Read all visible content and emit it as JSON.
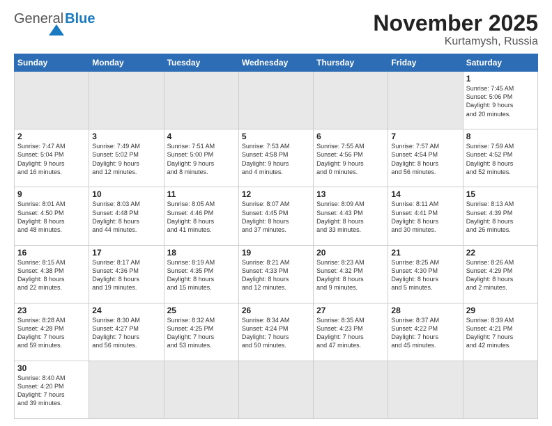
{
  "header": {
    "logo": {
      "general": "General",
      "blue": "Blue"
    },
    "month": "November 2025",
    "location": "Kurtamysh, Russia"
  },
  "weekdays": [
    "Sunday",
    "Monday",
    "Tuesday",
    "Wednesday",
    "Thursday",
    "Friday",
    "Saturday"
  ],
  "weeks": [
    [
      {
        "day": "",
        "info": "",
        "empty": true
      },
      {
        "day": "",
        "info": "",
        "empty": true
      },
      {
        "day": "",
        "info": "",
        "empty": true
      },
      {
        "day": "",
        "info": "",
        "empty": true
      },
      {
        "day": "",
        "info": "",
        "empty": true
      },
      {
        "day": "",
        "info": "",
        "empty": true
      },
      {
        "day": "1",
        "info": "Sunrise: 7:45 AM\nSunset: 5:06 PM\nDaylight: 9 hours\nand 20 minutes."
      }
    ],
    [
      {
        "day": "2",
        "info": "Sunrise: 7:47 AM\nSunset: 5:04 PM\nDaylight: 9 hours\nand 16 minutes."
      },
      {
        "day": "3",
        "info": "Sunrise: 7:49 AM\nSunset: 5:02 PM\nDaylight: 9 hours\nand 12 minutes."
      },
      {
        "day": "4",
        "info": "Sunrise: 7:51 AM\nSunset: 5:00 PM\nDaylight: 9 hours\nand 8 minutes."
      },
      {
        "day": "5",
        "info": "Sunrise: 7:53 AM\nSunset: 4:58 PM\nDaylight: 9 hours\nand 4 minutes."
      },
      {
        "day": "6",
        "info": "Sunrise: 7:55 AM\nSunset: 4:56 PM\nDaylight: 9 hours\nand 0 minutes."
      },
      {
        "day": "7",
        "info": "Sunrise: 7:57 AM\nSunset: 4:54 PM\nDaylight: 8 hours\nand 56 minutes."
      },
      {
        "day": "8",
        "info": "Sunrise: 7:59 AM\nSunset: 4:52 PM\nDaylight: 8 hours\nand 52 minutes."
      }
    ],
    [
      {
        "day": "9",
        "info": "Sunrise: 8:01 AM\nSunset: 4:50 PM\nDaylight: 8 hours\nand 48 minutes."
      },
      {
        "day": "10",
        "info": "Sunrise: 8:03 AM\nSunset: 4:48 PM\nDaylight: 8 hours\nand 44 minutes."
      },
      {
        "day": "11",
        "info": "Sunrise: 8:05 AM\nSunset: 4:46 PM\nDaylight: 8 hours\nand 41 minutes."
      },
      {
        "day": "12",
        "info": "Sunrise: 8:07 AM\nSunset: 4:45 PM\nDaylight: 8 hours\nand 37 minutes."
      },
      {
        "day": "13",
        "info": "Sunrise: 8:09 AM\nSunset: 4:43 PM\nDaylight: 8 hours\nand 33 minutes."
      },
      {
        "day": "14",
        "info": "Sunrise: 8:11 AM\nSunset: 4:41 PM\nDaylight: 8 hours\nand 30 minutes."
      },
      {
        "day": "15",
        "info": "Sunrise: 8:13 AM\nSunset: 4:39 PM\nDaylight: 8 hours\nand 26 minutes."
      }
    ],
    [
      {
        "day": "16",
        "info": "Sunrise: 8:15 AM\nSunset: 4:38 PM\nDaylight: 8 hours\nand 22 minutes."
      },
      {
        "day": "17",
        "info": "Sunrise: 8:17 AM\nSunset: 4:36 PM\nDaylight: 8 hours\nand 19 minutes."
      },
      {
        "day": "18",
        "info": "Sunrise: 8:19 AM\nSunset: 4:35 PM\nDaylight: 8 hours\nand 15 minutes."
      },
      {
        "day": "19",
        "info": "Sunrise: 8:21 AM\nSunset: 4:33 PM\nDaylight: 8 hours\nand 12 minutes."
      },
      {
        "day": "20",
        "info": "Sunrise: 8:23 AM\nSunset: 4:32 PM\nDaylight: 8 hours\nand 9 minutes."
      },
      {
        "day": "21",
        "info": "Sunrise: 8:25 AM\nSunset: 4:30 PM\nDaylight: 8 hours\nand 5 minutes."
      },
      {
        "day": "22",
        "info": "Sunrise: 8:26 AM\nSunset: 4:29 PM\nDaylight: 8 hours\nand 2 minutes."
      }
    ],
    [
      {
        "day": "23",
        "info": "Sunrise: 8:28 AM\nSunset: 4:28 PM\nDaylight: 7 hours\nand 59 minutes."
      },
      {
        "day": "24",
        "info": "Sunrise: 8:30 AM\nSunset: 4:27 PM\nDaylight: 7 hours\nand 56 minutes."
      },
      {
        "day": "25",
        "info": "Sunrise: 8:32 AM\nSunset: 4:25 PM\nDaylight: 7 hours\nand 53 minutes."
      },
      {
        "day": "26",
        "info": "Sunrise: 8:34 AM\nSunset: 4:24 PM\nDaylight: 7 hours\nand 50 minutes."
      },
      {
        "day": "27",
        "info": "Sunrise: 8:35 AM\nSunset: 4:23 PM\nDaylight: 7 hours\nand 47 minutes."
      },
      {
        "day": "28",
        "info": "Sunrise: 8:37 AM\nSunset: 4:22 PM\nDaylight: 7 hours\nand 45 minutes."
      },
      {
        "day": "29",
        "info": "Sunrise: 8:39 AM\nSunset: 4:21 PM\nDaylight: 7 hours\nand 42 minutes."
      }
    ],
    [
      {
        "day": "30",
        "info": "Sunrise: 8:40 AM\nSunset: 4:20 PM\nDaylight: 7 hours\nand 39 minutes."
      },
      {
        "day": "",
        "info": "",
        "empty": true
      },
      {
        "day": "",
        "info": "",
        "empty": true
      },
      {
        "day": "",
        "info": "",
        "empty": true
      },
      {
        "day": "",
        "info": "",
        "empty": true
      },
      {
        "day": "",
        "info": "",
        "empty": true
      },
      {
        "day": "",
        "info": "",
        "empty": true
      }
    ]
  ]
}
